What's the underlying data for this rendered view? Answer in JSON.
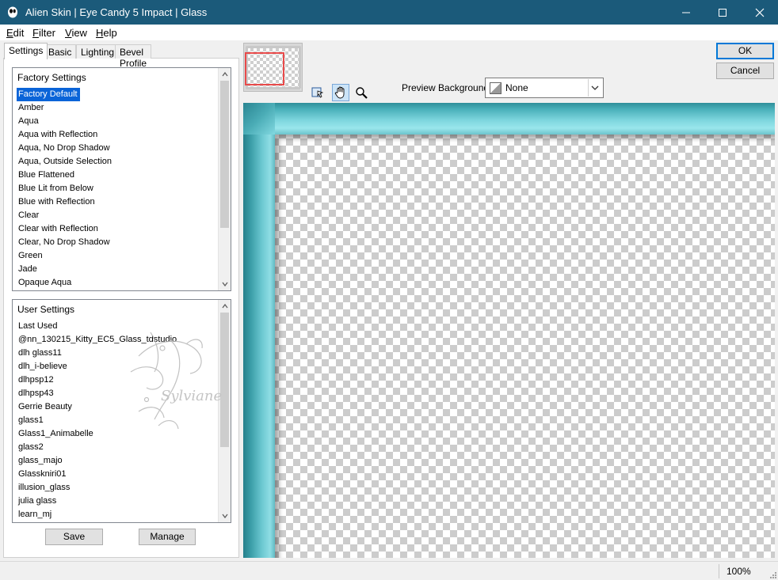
{
  "window": {
    "title": "Alien Skin | Eye Candy 5 Impact | Glass"
  },
  "menu": [
    {
      "label": "Edit",
      "mnemonic": "E",
      "rest": "dit"
    },
    {
      "label": "Filter",
      "mnemonic": "F",
      "rest": "ilter"
    },
    {
      "label": "View",
      "mnemonic": "V",
      "rest": "iew"
    },
    {
      "label": "Help",
      "mnemonic": "H",
      "rest": "elp"
    }
  ],
  "tabs": [
    "Settings",
    "Basic",
    "Lighting",
    "Bevel Profile"
  ],
  "factory": {
    "header": "Factory Settings",
    "items": [
      "Factory Default",
      "Amber",
      "Aqua",
      "Aqua with Reflection",
      "Aqua, No Drop Shadow",
      "Aqua, Outside Selection",
      "Blue Flattened",
      "Blue Lit from Below",
      "Blue with Reflection",
      "Clear",
      "Clear with Reflection",
      "Clear, No Drop Shadow",
      "Green",
      "Jade",
      "Opaque Aqua"
    ]
  },
  "user": {
    "header": "User Settings",
    "items": [
      "Last Used",
      "@nn_130215_Kitty_EC5_Glass_tdstudio",
      "dlh glass11",
      "dlh_i-believe",
      "dlhpsp12",
      "dlhpsp43",
      "Gerrie Beauty",
      "glass1",
      "Glass1_Animabelle",
      "glass2",
      "glass_majo",
      "Glasskniri01",
      "illusion_glass",
      "julia glass",
      "learn_mj"
    ]
  },
  "buttons": {
    "save": "Save",
    "manage": "Manage",
    "ok": "OK",
    "cancel": "Cancel"
  },
  "preview_background": {
    "label": "Preview Background:",
    "value": "None"
  },
  "watermark": "Sylviane",
  "status": {
    "zoom": "100%"
  },
  "colors": {
    "titlebar": "#1b5a7a",
    "selection": "#0a64d8",
    "glass": "#7ed6de"
  }
}
